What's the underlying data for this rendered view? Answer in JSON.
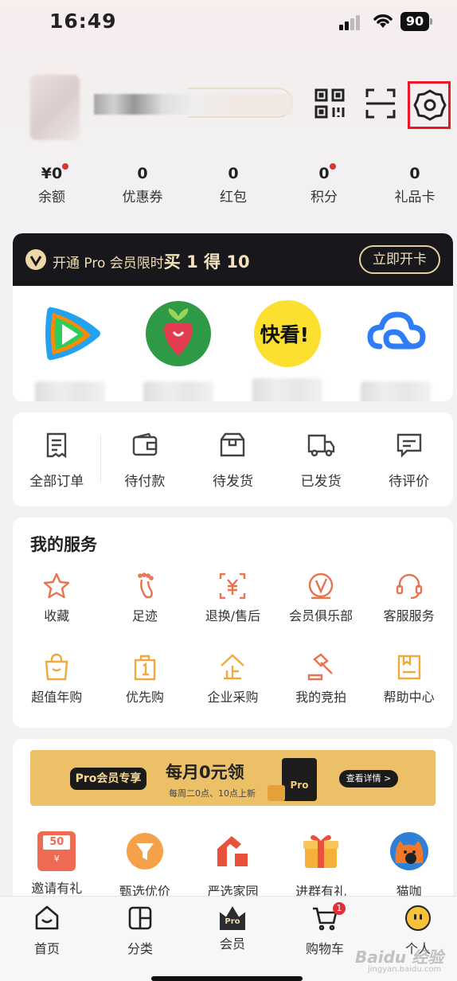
{
  "status_bar": {
    "time": "16:49",
    "battery": "90"
  },
  "header": {
    "qr_icon": "qr-code-icon",
    "scan_icon": "scan-icon",
    "settings_icon": "gear-icon"
  },
  "stats": [
    {
      "value": "¥0",
      "label": "余额",
      "dot": true
    },
    {
      "value": "0",
      "label": "优惠券",
      "dot": false
    },
    {
      "value": "0",
      "label": "红包",
      "dot": false
    },
    {
      "value": "0",
      "label": "积分",
      "dot": true
    },
    {
      "value": "0",
      "label": "礼品卡",
      "dot": false
    }
  ],
  "pro_card": {
    "promo_prefix": "开通 Pro 会员限时",
    "promo_bold": "买 1 得 10",
    "button": "立即开卡",
    "apps": [
      {
        "icon": "tencent-video-icon"
      },
      {
        "icon": "radish-icon"
      },
      {
        "icon": "kuaikan-icon",
        "logo_text": "快看!"
      },
      {
        "icon": "cloud-icon"
      }
    ]
  },
  "orders": [
    {
      "label": "全部订单",
      "icon": "document-icon"
    },
    {
      "label": "待付款",
      "icon": "wallet-icon"
    },
    {
      "label": "待发货",
      "icon": "box-icon"
    },
    {
      "label": "已发货",
      "icon": "truck-icon"
    },
    {
      "label": "待评价",
      "icon": "comment-icon"
    }
  ],
  "services": {
    "title": "我的服务",
    "items": [
      {
        "label": "收藏",
        "icon": "star-icon"
      },
      {
        "label": "足迹",
        "icon": "footprint-icon"
      },
      {
        "label": "退换/售后",
        "icon": "refund-icon"
      },
      {
        "label": "会员俱乐部",
        "icon": "vip-club-icon"
      },
      {
        "label": "客服服务",
        "icon": "headset-icon"
      },
      {
        "label": "超值年购",
        "icon": "shopping-bag-icon"
      },
      {
        "label": "优先购",
        "icon": "priority-bag-icon"
      },
      {
        "label": "企业采购",
        "icon": "enterprise-icon"
      },
      {
        "label": "我的竞拍",
        "icon": "auction-hammer-icon"
      },
      {
        "label": "帮助中心",
        "icon": "help-book-icon"
      }
    ]
  },
  "promo_banner": {
    "tag": "Pro会员专享",
    "main": "每月0元领",
    "sub": "每周二0点、10点上新",
    "button": "查看详情 >",
    "bag_text": "Pro"
  },
  "activities": [
    {
      "label": "邀请有礼",
      "icon": "coupon-icon",
      "value": "50",
      "currency": "¥"
    },
    {
      "label": "甄选优价",
      "icon": "filter-icon"
    },
    {
      "label": "严选家园",
      "icon": "home-logo-icon"
    },
    {
      "label": "进群有礼",
      "icon": "gift-box-icon"
    },
    {
      "label": "猫咖",
      "icon": "cat-icon"
    }
  ],
  "tabbar": [
    {
      "label": "首页",
      "icon": "home-icon"
    },
    {
      "label": "分类",
      "icon": "category-icon"
    },
    {
      "label": "会员",
      "icon": "pro-crown-icon",
      "badge_text": "Pro"
    },
    {
      "label": "购物车",
      "icon": "cart-icon",
      "badge": "1"
    },
    {
      "label": "个人",
      "icon": "profile-icon"
    }
  ],
  "watermark": {
    "text": "Baidu 经验",
    "sub": "jingyan.baidu.com"
  },
  "colors": {
    "accent": "#e8734f",
    "gold": "#f1dcb4",
    "badge": "#e0313b"
  }
}
